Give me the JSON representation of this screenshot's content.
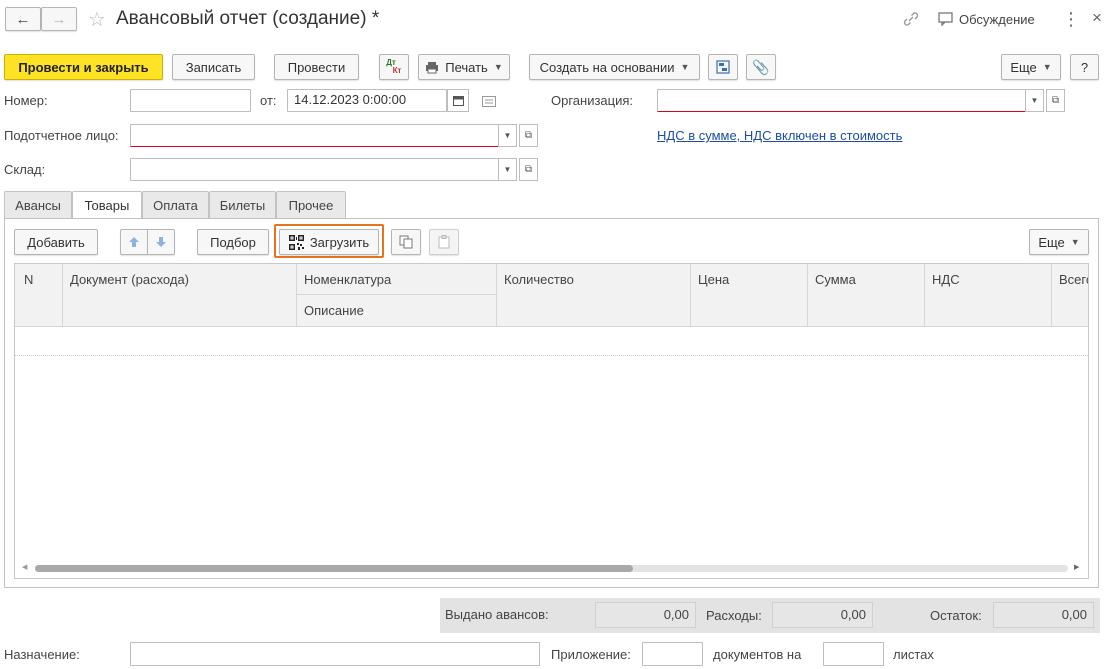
{
  "window": {
    "title": "Авансовый отчет (создание) *",
    "discussion": "Обсуждение"
  },
  "toolbar": {
    "post_close": "Провести и закрыть",
    "save": "Записать",
    "post": "Провести",
    "dtkt_top": "Дт",
    "dtkt_bottom": "Кт",
    "print": "Печать",
    "create_based": "Создать на основании",
    "more": "Еще",
    "help": "?"
  },
  "form": {
    "number_label": "Номер:",
    "number_value": "",
    "date_label": "от:",
    "date_value": "14.12.2023  0:00:00",
    "org_label": "Организация:",
    "org_value": "",
    "person_label": "Подотчетное лицо:",
    "person_value": "",
    "vat_link": "НДС в сумме, НДС включен в стоимость",
    "warehouse_label": "Склад:",
    "warehouse_value": ""
  },
  "tabs": [
    "Авансы",
    "Товары",
    "Оплата",
    "Билеты",
    "Прочее"
  ],
  "active_tab": "Товары",
  "goods_toolbar": {
    "add": "Добавить",
    "selection": "Подбор",
    "load": "Загрузить",
    "more": "Еще"
  },
  "table": {
    "columns": {
      "n": "N",
      "doc": "Документ (расхода)",
      "nomenclature": "Номенклатура",
      "description": "Описание",
      "quantity": "Количество",
      "price": "Цена",
      "sum": "Сумма",
      "vat": "НДС",
      "total": "Всего"
    }
  },
  "totals": {
    "advances_label": "Выдано авансов:",
    "advances_value": "0,00",
    "expenses_label": "Расходы:",
    "expenses_value": "0,00",
    "balance_label": "Остаток:",
    "balance_value": "0,00"
  },
  "footer": {
    "purpose_label": "Назначение:",
    "purpose_value": "",
    "attachment_label": "Приложение:",
    "attachment_value": "",
    "docs_on_label": "документов на",
    "sheets_value": "",
    "sheets_label": "листах"
  },
  "colors": {
    "primary": "#fde324",
    "highlight": "#e8731a",
    "link": "#1c4ea7",
    "required": "#d8001b"
  }
}
